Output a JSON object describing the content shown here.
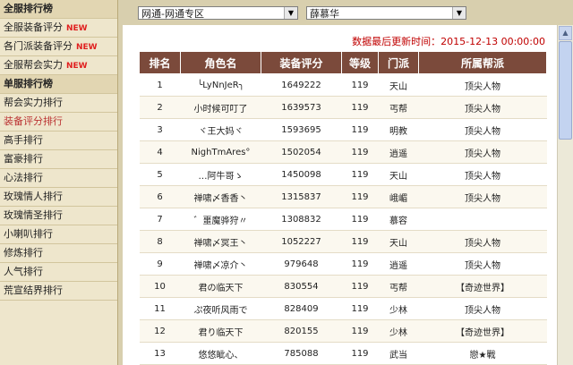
{
  "sidebar": {
    "items": [
      {
        "label": "全服排行榜",
        "type": "header",
        "new": ""
      },
      {
        "label": "全服装备评分",
        "type": "item",
        "new": "NEW"
      },
      {
        "label": "各门派装备评分",
        "type": "item",
        "new": "NEW"
      },
      {
        "label": "全服帮会实力",
        "type": "item",
        "new": "NEW"
      },
      {
        "label": "单服排行榜",
        "type": "header",
        "new": ""
      },
      {
        "label": "帮会实力排行",
        "type": "item",
        "new": ""
      },
      {
        "label": "装备评分排行",
        "type": "active",
        "new": ""
      },
      {
        "label": "高手排行",
        "type": "item",
        "new": ""
      },
      {
        "label": "富豪排行",
        "type": "item",
        "new": ""
      },
      {
        "label": "心法排行",
        "type": "item",
        "new": ""
      },
      {
        "label": "玫瑰情人排行",
        "type": "item",
        "new": ""
      },
      {
        "label": "玫瑰情圣排行",
        "type": "item",
        "new": ""
      },
      {
        "label": "小喇叭排行",
        "type": "item",
        "new": ""
      },
      {
        "label": "修炼排行",
        "type": "item",
        "new": ""
      },
      {
        "label": "人气排行",
        "type": "item",
        "new": ""
      },
      {
        "label": "荒宣结界排行",
        "type": "item",
        "new": ""
      }
    ]
  },
  "filters": {
    "region": "网通-网通专区",
    "server": "薛慕华"
  },
  "updated_text": "数据最后更新时间：2015-12-13 00:00:00",
  "table": {
    "headers": [
      "排名",
      "角色名",
      "装备评分",
      "等级",
      "门派",
      "所属帮派"
    ],
    "rows": [
      [
        "1",
        "╰LyNnJeR╮",
        "1649222",
        "119",
        "天山",
        "顶尖人物"
      ],
      [
        "2",
        "小时候可叮了",
        "1639573",
        "119",
        "丐帮",
        "顶尖人物"
      ],
      [
        "3",
        "ヾ王大妈ヾ",
        "1593695",
        "119",
        "明教",
        "顶尖人物"
      ],
      [
        "4",
        "NighTmAres°",
        "1502054",
        "119",
        "逍遥",
        "顶尖人物"
      ],
      [
        "5",
        "…阿牛哥ゝ",
        "1450098",
        "119",
        "天山",
        "顶尖人物"
      ],
      [
        "6",
        "禅啸〆香香丶",
        "1315837",
        "119",
        "峨嵋",
        "顶尖人物"
      ],
      [
        "7",
        "゛噩魔骅狩〃",
        "1308832",
        "119",
        "慕容",
        ""
      ],
      [
        "8",
        "禅啸〆冥王丶",
        "1052227",
        "119",
        "天山",
        "顶尖人物"
      ],
      [
        "9",
        "禅啸〆凉介丶",
        "979648",
        "119",
        "逍遥",
        "顶尖人物"
      ],
      [
        "10",
        "君の临天下",
        "830554",
        "119",
        "丐帮",
        "【奇迹世界】"
      ],
      [
        "11",
        "ぷ夜听风雨で",
        "828409",
        "119",
        "少林",
        "顶尖人物"
      ],
      [
        "12",
        "君り临天下",
        "820155",
        "119",
        "少林",
        "【奇迹世界】"
      ],
      [
        "13",
        "悠悠眦心、",
        "785088",
        "119",
        "武当",
        "戀★戰"
      ]
    ]
  },
  "icons": {
    "dropdown": "chevron-down-icon",
    "scroll_up": "scroll-up-icon"
  },
  "colors": {
    "header_bg": "#7b4a3b",
    "updated_text": "#c00000",
    "new_badge": "#e02020"
  }
}
